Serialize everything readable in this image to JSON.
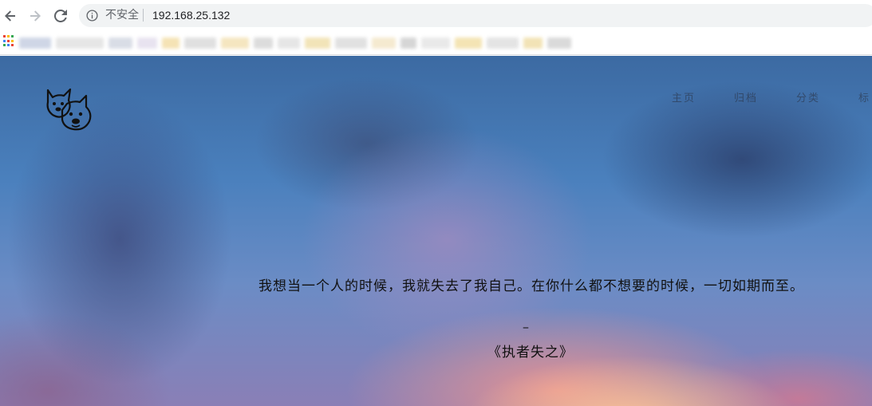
{
  "browser": {
    "security_label": "不安全",
    "url": "192.168.25.132"
  },
  "site": {
    "nav": [
      {
        "label": "主页"
      },
      {
        "label": "归档"
      },
      {
        "label": "分类"
      },
      {
        "label": "标"
      }
    ],
    "quote": "我想当一个人的时候，我就失去了我自己。在你什么都不想要的时候，一切如期而至。",
    "dash": "–",
    "author": "《执者失之》"
  },
  "colors": {
    "sky_top": "#3c6aa2",
    "sky_bottom": "#8a7fb6",
    "sunset_glow": "#f5a08c"
  },
  "icons": {
    "back": "back-arrow-icon",
    "forward": "forward-arrow-icon",
    "reload": "reload-icon",
    "info": "info-icon",
    "apps": "apps-grid-icon",
    "logo": "dogs-logo-icon"
  }
}
